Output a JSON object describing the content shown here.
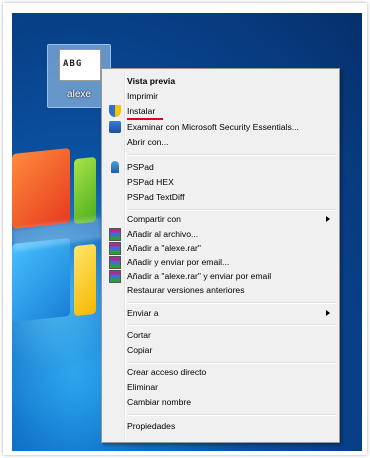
{
  "file": {
    "name": "alexe",
    "thumb_text": "ABG"
  },
  "menu": {
    "items": [
      {
        "label": "Vista previa",
        "bold": true
      },
      {
        "label": "Imprimir"
      },
      {
        "label": "Instalar",
        "icon": "uac-shield-icon"
      },
      {
        "label": "Examinar con Microsoft Security Essentials...",
        "icon": "security-essentials-icon"
      },
      {
        "label": "Abrir con..."
      },
      {
        "label": "PSPad",
        "icon": "pspad-icon"
      },
      {
        "label": "PSPad HEX"
      },
      {
        "label": "PSPad TextDiff"
      },
      {
        "label": "Compartir con",
        "submenu": true
      },
      {
        "label": "Añadir al archivo...",
        "icon": "winrar-icon"
      },
      {
        "label": "Añadir a \"alexe.rar\"",
        "icon": "winrar-icon"
      },
      {
        "label": "Añadir y enviar por email...",
        "icon": "winrar-icon"
      },
      {
        "label": "Añadir a \"alexe.rar\" y enviar por email",
        "icon": "winrar-icon"
      },
      {
        "label": "Restaurar versiones anteriores"
      },
      {
        "label": "Enviar a",
        "submenu": true
      },
      {
        "label": "Cortar"
      },
      {
        "label": "Copiar"
      },
      {
        "label": "Crear acceso directo"
      },
      {
        "label": "Eliminar"
      },
      {
        "label": "Cambiar nombre"
      },
      {
        "label": "Propiedades"
      }
    ]
  },
  "colors": {
    "highlight_underline": "#e3001b",
    "menu_bg": "#f0f0f0"
  }
}
